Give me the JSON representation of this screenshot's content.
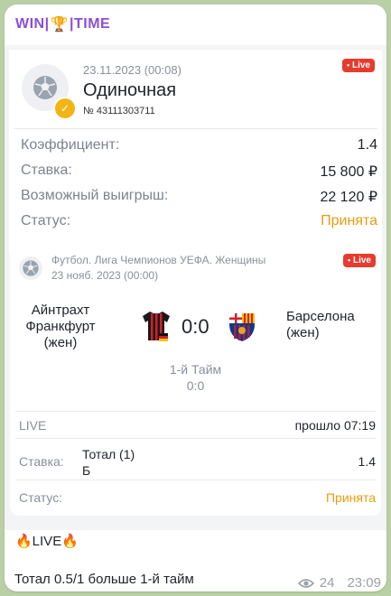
{
  "header": {
    "brand_left": "WIN",
    "brand_sep": "|",
    "brand_right": "TIME",
    "trophy_icon": "🏆"
  },
  "bet_card": {
    "datetime": "23.11.2023 (00:08)",
    "type": "Одиночная",
    "number": "№ 43111303711",
    "live_badge": "Live",
    "rows": [
      {
        "label": "Коэффициент:",
        "value": "1.4"
      },
      {
        "label": "Ставка:",
        "value": "15 800 ₽"
      },
      {
        "label": "Возможный выигрыш:",
        "value": "22 120 ₽"
      },
      {
        "label": "Статус:",
        "value": "Принята"
      }
    ]
  },
  "event_card": {
    "league": "Футбол. Лига Чемпионов УЕФА. Женщины",
    "date": "23 нояб. 2023 (00:00)",
    "live_badge": "Live",
    "team_home": "Айнтрахт Франкфурт (жен)",
    "team_away": "Барселона (жен)",
    "score": "0:0",
    "period": "1-й Тайм",
    "period_score": "0:0",
    "live_label": "LIVE",
    "elapsed": "прошло 07:19",
    "stake_label": "Ставка:",
    "stake_value": "Тотал (1) Б",
    "stake_coef": "1.4",
    "status_label": "Статус:",
    "status_value": "Принята"
  },
  "message": {
    "line1": "🔥LIVE🔥",
    "line2": "Тотал 0.5/1 больше 1-й тайм",
    "views": "24",
    "time": "23:09"
  },
  "colors": {
    "brand": "#8b4fd6",
    "accent": "#e89c0f",
    "live": "#e63b2e",
    "chat_bg": "#b9cfa6"
  }
}
